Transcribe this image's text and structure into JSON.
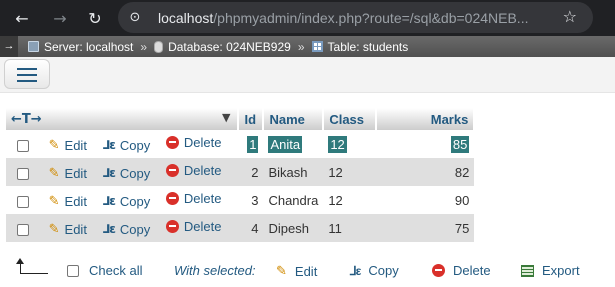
{
  "browser": {
    "back_icon": "arrow-left-icon",
    "forward_icon": "arrow-right-icon",
    "reload_icon": "reload-icon",
    "url_host": "localhost",
    "url_path": "/phpmyadmin/index.php?route=/sql&db=024NEB...",
    "bookmark_icon": "star-icon"
  },
  "breadcrumb": {
    "toggle": "→",
    "server": "Server: localhost",
    "database": "Database: 024NEB929",
    "table": "Table: students",
    "separator": "»"
  },
  "table": {
    "header": {
      "id": "Id",
      "name": "Name",
      "class": "Class",
      "marks": "Marks"
    },
    "actions": {
      "edit": "Edit",
      "copy": "Copy",
      "delete": "Delete"
    },
    "rows": [
      {
        "id": "1",
        "name": "Anita",
        "class": "12",
        "marks": "85"
      },
      {
        "id": "2",
        "name": "Bikash",
        "class": "12",
        "marks": "82"
      },
      {
        "id": "3",
        "name": "Chandra",
        "class": "12",
        "marks": "90"
      },
      {
        "id": "4",
        "name": "Dipesh",
        "class": "11",
        "marks": "75"
      }
    ]
  },
  "footer": {
    "check_all": "Check all",
    "with_selected": "With selected:",
    "edit": "Edit",
    "copy": "Copy",
    "delete": "Delete",
    "export": "Export"
  },
  "colors": {
    "link": "#235a81",
    "highlight": "#2f7a7c",
    "delete": "#d9302a"
  }
}
